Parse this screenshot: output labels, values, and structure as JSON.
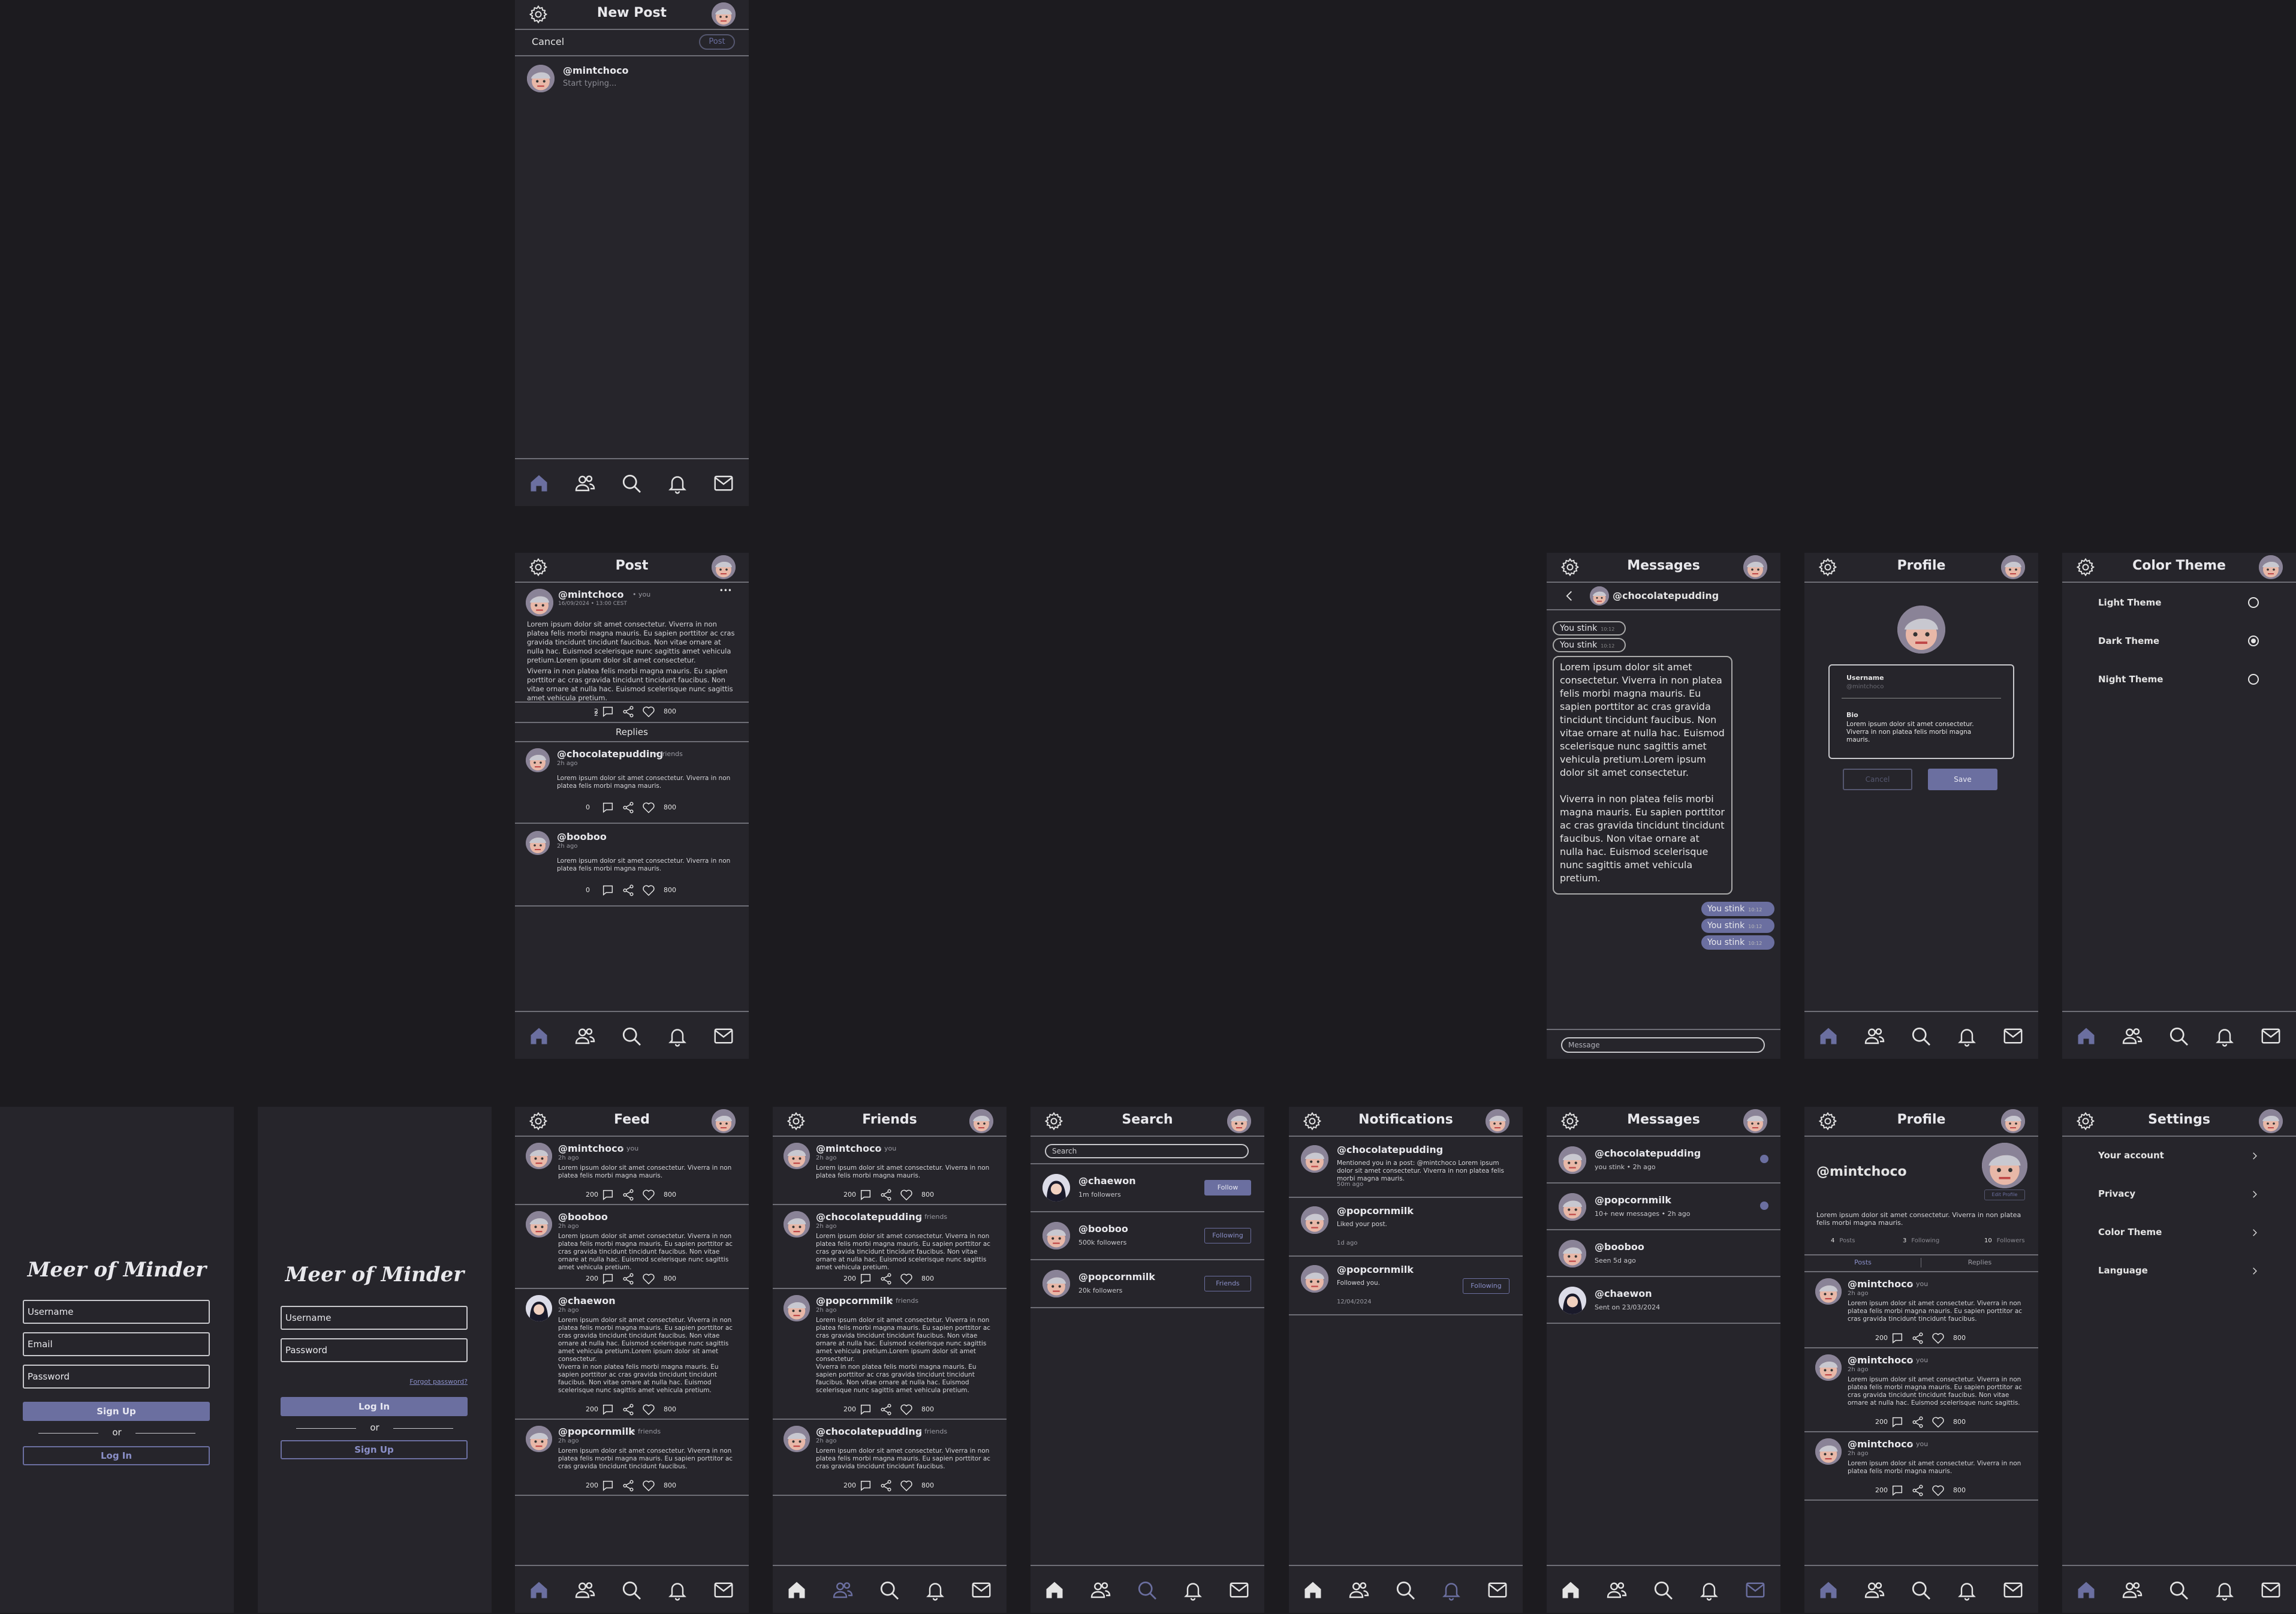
{
  "colors": {
    "bg": "#1c1b1f",
    "screen": "#26252b",
    "accent": "#6b6fa0",
    "divider": "#6e6e76"
  },
  "icons": {
    "settings": "gear-icon",
    "home": "home-icon",
    "friends": "friends-icon",
    "search": "search-icon",
    "notifications": "bell-icon",
    "messages": "mail-icon"
  },
  "new_post": {
    "title": "New Post",
    "cancel": "Cancel",
    "post": "Post",
    "user": "@mintchoco",
    "placeholder": "Start typing..."
  },
  "post_detail": {
    "title": "Post",
    "user": "@mintchoco",
    "tag": "• you",
    "timestamp": "16/09/2024 • 13:00 CEST",
    "menu": "•••",
    "body": "Lorem ipsum dolor sit amet consectetur. Viverra in non platea felis morbi magna mauris. Eu sapien porttitor ac cras gravida tincidunt tincidunt faucibus. Non vitae ornare at nulla hac. Euismod scelerisque nunc sagittis amet vehicula pretium.Lorem ipsum dolor sit amet consectetur.",
    "body2": "Viverra in non platea felis morbi magna mauris. Eu sapien porttitor ac cras gravida tincidunt tincidunt faucibus. Non vitae ornare at nulla hac. Euismod scelerisque nunc sagittis amet vehicula pretium.",
    "comments": "2",
    "likes": "800",
    "replies_label": "Replies",
    "replies": [
      {
        "user": "@chocolatepudding",
        "tag": "• friends",
        "time": "2h ago",
        "body": "Lorem ipsum dolor sit amet consectetur. Viverra in non platea felis morbi magna mauris.",
        "comments": "0",
        "likes": "800"
      },
      {
        "user": "@booboo",
        "tag": "",
        "time": "2h ago",
        "body": "Lorem ipsum dolor sit amet consectetur. Viverra in non platea felis morbi magna mauris.",
        "comments": "0",
        "likes": "800"
      }
    ]
  },
  "chat": {
    "title": "Messages",
    "contact": "@chocolatepudding",
    "msg_in": "You stink",
    "time": "10:12",
    "long_msg": "Lorem ipsum dolor sit amet consectetur. Viverra in non platea felis morbi magna mauris. Eu sapien porttitor ac cras gravida tincidunt tincidunt faucibus. Non vitae ornare at nulla hac. Euismod scelerisque nunc sagittis amet vehicula pretium.Lorem ipsum dolor sit amet consectetur.",
    "long_msg2": "Viverra in non platea felis morbi magna mauris. Eu sapien porttitor ac cras gravida tincidunt tincidunt faucibus. Non vitae ornare at nulla hac. Euismod scelerisque nunc sagittis amet vehicula pretium.",
    "msg_out": "You stink",
    "placeholder": "Message"
  },
  "edit_profile": {
    "title": "Profile",
    "username_label": "Username",
    "username_placeholder": "@mintchoco",
    "bio_label": "Bio",
    "bio": "Lorem ipsum dolor sit amet consectetur. Viverra in non platea felis morbi magna mauris.",
    "cancel": "Cancel",
    "save": "Save"
  },
  "color_theme": {
    "title": "Color Theme",
    "options": [
      {
        "label": "Light Theme",
        "selected": false
      },
      {
        "label": "Dark Theme",
        "selected": true
      },
      {
        "label": "Night Theme",
        "selected": false
      }
    ]
  },
  "signup": {
    "brand": "Meer of Minder",
    "username": "Username",
    "email": "Email",
    "password": "Password",
    "signup": "Sign Up",
    "or": "or",
    "login": "Log In"
  },
  "login": {
    "brand": "Meer of Minder",
    "username": "Username",
    "password": "Password",
    "forgot": "Forgot password?",
    "login": "Log In",
    "or": "or",
    "signup": "Sign Up"
  },
  "feed": {
    "title": "Feed",
    "posts": [
      {
        "user": "@mintchoco",
        "tag": "• you",
        "time": "2h ago",
        "body": "Lorem ipsum dolor sit amet consectetur. Viverra in non platea felis morbi magna mauris.",
        "comments": "200",
        "likes": "800"
      },
      {
        "user": "@booboo",
        "tag": "",
        "time": "2h ago",
        "body": "Lorem ipsum dolor sit amet consectetur. Viverra in non platea felis morbi magna mauris. Eu sapien porttitor ac cras gravida tincidunt tincidunt faucibus. Non vitae ornare at nulla hac. Euismod scelerisque nunc sagittis amet vehicula pretium.",
        "comments": "200",
        "likes": "800"
      },
      {
        "user": "@chaewon",
        "tag": "",
        "time": "2h ago",
        "body": "Lorem ipsum dolor sit amet consectetur. Viverra in non platea felis morbi magna mauris. Eu sapien porttitor ac cras gravida tincidunt tincidunt faucibus. Non vitae ornare at nulla hac. Euismod scelerisque nunc sagittis amet vehicula pretium.Lorem ipsum dolor sit amet consectetur.",
        "body2": "Viverra in non platea felis morbi magna mauris. Eu sapien porttitor ac cras gravida tincidunt tincidunt faucibus. Non vitae ornare at nulla hac. Euismod scelerisque nunc sagittis amet vehicula pretium.",
        "comments": "200",
        "likes": "800"
      },
      {
        "user": "@popcornmilk",
        "tag": "• friends",
        "time": "2h ago",
        "body": "Lorem ipsum dolor sit amet consectetur. Viverra in non platea felis morbi magna mauris. Eu sapien porttitor ac cras gravida tincidunt tincidunt faucibus.",
        "comments": "200",
        "likes": "800"
      }
    ]
  },
  "friends": {
    "title": "Friends",
    "posts": [
      {
        "user": "@mintchoco",
        "tag": "• you",
        "time": "2h ago",
        "body": "Lorem ipsum dolor sit amet consectetur. Viverra in non platea felis morbi magna mauris.",
        "comments": "200",
        "likes": "800"
      },
      {
        "user": "@chocolatepudding",
        "tag": "• friends",
        "time": "2h ago",
        "body": "Lorem ipsum dolor sit amet consectetur. Viverra in non platea felis morbi magna mauris. Eu sapien porttitor ac cras gravida tincidunt tincidunt faucibus. Non vitae ornare at nulla hac. Euismod scelerisque nunc sagittis amet vehicula pretium.",
        "comments": "200",
        "likes": "800"
      },
      {
        "user": "@popcornmilk",
        "tag": "• friends",
        "time": "2h ago",
        "body": "Lorem ipsum dolor sit amet consectetur. Viverra in non platea felis morbi magna mauris. Eu sapien porttitor ac cras gravida tincidunt tincidunt faucibus. Non vitae ornare at nulla hac. Euismod scelerisque nunc sagittis amet vehicula pretium.Lorem ipsum dolor sit amet consectetur.",
        "body2": "Viverra in non platea felis morbi magna mauris. Eu sapien porttitor ac cras gravida tincidunt tincidunt faucibus. Non vitae ornare at nulla hac. Euismod scelerisque nunc sagittis amet vehicula pretium.",
        "comments": "200",
        "likes": "800"
      },
      {
        "user": "@chocolatepudding",
        "tag": "• friends",
        "time": "2h ago",
        "body": "Lorem ipsum dolor sit amet consectetur. Viverra in non platea felis morbi magna mauris. Eu sapien porttitor ac cras gravida tincidunt tincidunt faucibus.",
        "comments": "200",
        "likes": "800"
      }
    ]
  },
  "search": {
    "title": "Search",
    "placeholder": "Search",
    "results": [
      {
        "user": "@chaewon",
        "followers": "1m followers",
        "action": "Follow"
      },
      {
        "user": "@booboo",
        "followers": "500k followers",
        "action": "Following"
      },
      {
        "user": "@popcornmilk",
        "followers": "20k followers",
        "action": "Friends"
      }
    ]
  },
  "notifications": {
    "title": "Notifications",
    "items": [
      {
        "user": "@chocolatepudding",
        "text": "Mentioned you in a post: @mintchoco Lorem ipsum dolor sit amet consectetur. Viverra in non platea felis morbi magna mauris.",
        "time": "50m ago",
        "action": ""
      },
      {
        "user": "@popcornmilk",
        "text": "Liked your post.",
        "time": "1d ago",
        "action": ""
      },
      {
        "user": "@popcornmilk",
        "text": "Followed you.",
        "time": "12/04/2024",
        "action": "Following"
      }
    ]
  },
  "inbox": {
    "title": "Messages",
    "items": [
      {
        "user": "@chocolatepudding",
        "sub": "you stink • 2h ago",
        "unread": true
      },
      {
        "user": "@popcornmilk",
        "sub": "10+ new messages • 2h ago",
        "unread": true
      },
      {
        "user": "@booboo",
        "sub": "Seen 5d ago",
        "unread": false
      },
      {
        "user": "@chaewon",
        "sub": "Sent on 23/03/2024",
        "unread": false
      }
    ]
  },
  "profile": {
    "title": "Profile",
    "user": "@mintchoco",
    "edit": "Edit Profile",
    "bio": "Lorem ipsum dolor sit amet consectetur. Viverra in non platea felis morbi magna mauris.",
    "stats": [
      {
        "n": "4",
        "l": "Posts"
      },
      {
        "n": "3",
        "l": "Following"
      },
      {
        "n": "10",
        "l": "Followers"
      }
    ],
    "tabs": [
      "Posts",
      "Replies"
    ],
    "posts": [
      {
        "user": "@mintchoco",
        "tag": "• you",
        "time": "2h ago",
        "body": "Lorem ipsum dolor sit amet consectetur. Viverra in non platea felis morbi magna mauris. Eu sapien porttitor ac cras gravida tincidunt tincidunt faucibus.",
        "comments": "200",
        "likes": "800"
      },
      {
        "user": "@mintchoco",
        "tag": "• you",
        "time": "2h ago",
        "body": "Lorem ipsum dolor sit amet consectetur. Viverra in non platea felis morbi magna mauris. Eu sapien porttitor ac cras gravida tincidunt tincidunt faucibus. Non vitae ornare at nulla hac. Euismod scelerisque nunc sagittis.",
        "comments": "200",
        "likes": "800"
      },
      {
        "user": "@mintchoco",
        "tag": "• you",
        "time": "2h ago",
        "body": "Lorem ipsum dolor sit amet consectetur. Viverra in non platea felis morbi magna mauris.",
        "comments": "200",
        "likes": "800"
      }
    ]
  },
  "settings": {
    "title": "Settings",
    "items": [
      "Your account",
      "Privacy",
      "Color Theme",
      "Language"
    ]
  }
}
